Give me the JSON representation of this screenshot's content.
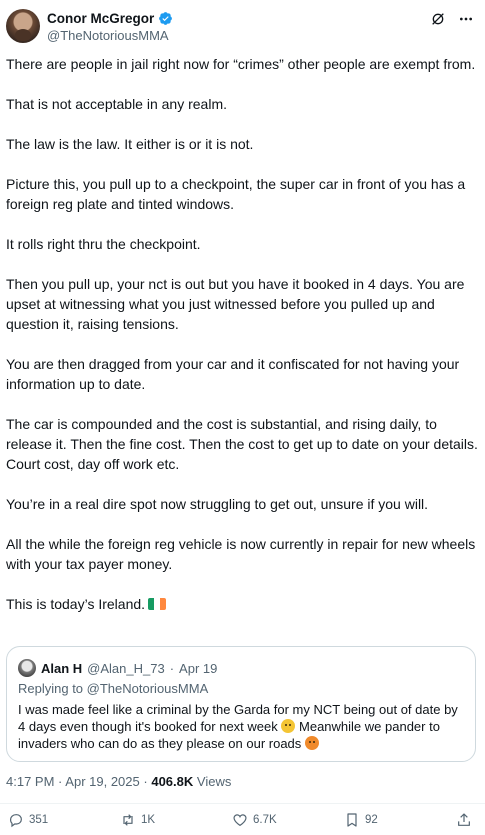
{
  "author": {
    "name": "Conor McGregor",
    "handle": "@TheNotoriousMMA"
  },
  "post": {
    "paragraphs": [
      "There are people in jail right now for “crimes” other people are exempt from.",
      "That is not acceptable in any realm.",
      "The law is the law. It either is or it is not.",
      "Picture this, you pull up to a checkpoint, the super car in front of you has a foreign reg plate and tinted windows.",
      "It rolls right thru the checkpoint.",
      "Then you pull up, your nct is out but you have it booked in 4 days. You are upset at witnessing what you just witnessed before you pulled up and question it, raising tensions.",
      "You are then dragged from your car and it confiscated for not having your information up to date.",
      "The car is compounded and the cost is substantial, and rising daily, to release it. Then the fine cost. Then the cost to get up to date on your details. Court cost, day off work etc.",
      "You’re in a real dire spot now struggling to get out, unsure if you will.",
      "All the while the foreign reg vehicle is now currently in repair for new wheels with your tax payer money."
    ],
    "closing": "This is today’s Ireland.",
    "closing_flag_icon": "ireland-flag-icon"
  },
  "quote": {
    "name": "Alan H",
    "handle": "@Alan_H_73",
    "separator": "·",
    "date": "Apr 19",
    "replying_prefix": "Replying to",
    "replying_to": "@TheNotoriousMMA",
    "text_part1": "I was made feel like a criminal by the Garda for my NCT being out of date by 4 days even though it's booked for next week",
    "text_part2": "Meanwhile we pander to invaders who can do as they please on our roads"
  },
  "meta": {
    "time": "4:17 PM",
    "separator": "·",
    "date": "Apr 19, 2025",
    "views_count": "406.8K",
    "views_label": "Views"
  },
  "actions": {
    "replies": "351",
    "reposts": "1K",
    "likes": "6.7K",
    "bookmarks": "92"
  },
  "colors": {
    "verified": "#1d9bf0",
    "secondary_text": "#536471",
    "border": "#cfd9de"
  }
}
